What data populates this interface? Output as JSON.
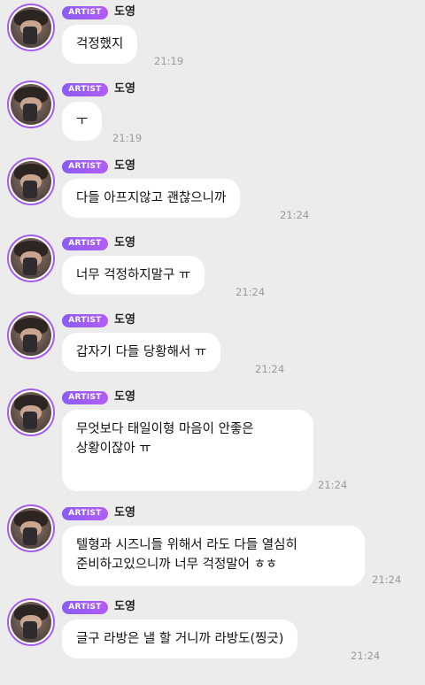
{
  "badge_label": "ARTIST",
  "messages": [
    {
      "sender": "도영",
      "lines": [
        "걱정했지"
      ],
      "time": "21:19"
    },
    {
      "sender": "도영",
      "lines": [
        "ㅜ"
      ],
      "time": "21:19"
    },
    {
      "sender": "도영",
      "lines": [
        "다들 아프지않고 괜찮으니까"
      ],
      "time": "21:24"
    },
    {
      "sender": "도영",
      "lines": [
        "너무 걱정하지말구 ㅠ"
      ],
      "time": "21:24"
    },
    {
      "sender": "도영",
      "lines": [
        "갑자기 다들 당황해서 ㅠ"
      ],
      "time": "21:24"
    },
    {
      "sender": "도영",
      "lines": [
        "무엇보다 태일이형 마음이 안좋은",
        "상황이잖아 ㅠ"
      ],
      "time": "21:24"
    },
    {
      "sender": "도영",
      "lines": [
        "텔형과 시즈니들 위해서 라도 다들 열심히",
        "준비하고있으니까 너무 걱정말어 ㅎㅎ"
      ],
      "time": "21:24"
    },
    {
      "sender": "도영",
      "lines": [
        "글구 라방은 낼 할 거니까 라방도(찡긋)"
      ],
      "time": "21:24"
    }
  ],
  "colors": {
    "background": "#ececec",
    "bubble": "#ffffff",
    "badge_start": "#8a5cf5",
    "badge_end": "#b25df3",
    "avatar_ring": "#a55cf0",
    "timestamp": "#9a9a9a"
  },
  "icons": {
    "avatar": "profile-photo"
  }
}
